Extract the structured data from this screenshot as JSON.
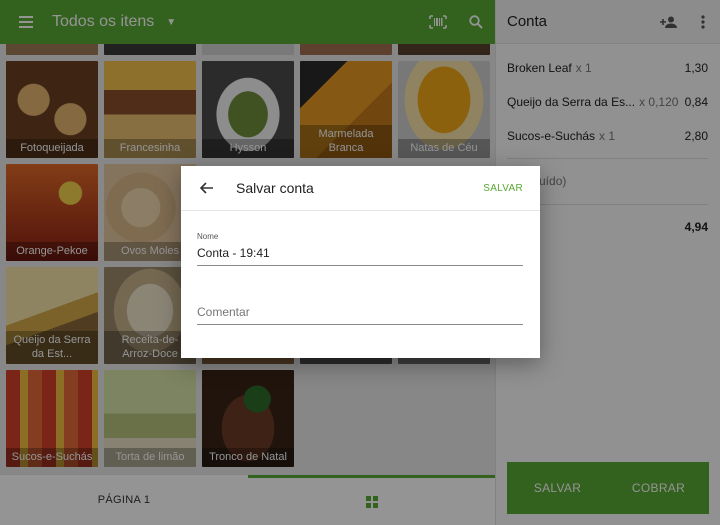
{
  "topbar": {
    "title": "Todos os itens",
    "menu_icon": "menu-icon",
    "barcode_icon": "barcode-icon",
    "search_icon": "search-icon",
    "color": "#59a834"
  },
  "grid": {
    "tiles": [
      {
        "label": "Fotoqueijada",
        "color": "#8a5a32"
      },
      {
        "label": "Francesinha",
        "color": "#b98a3a"
      },
      {
        "label": "Hysson",
        "color": "#6e8b3f"
      },
      {
        "label": "Marmelada Branca",
        "color": "#c98a2a"
      },
      {
        "label": "Natas de Céu",
        "color": "#e0a020"
      },
      {
        "label": "Orange-Pekoe",
        "color": "#b8451e"
      },
      {
        "label": "Ovos Moles",
        "color": "#d8b98a"
      },
      {
        "label": "Queijo da Serra da Est...",
        "color": "#d6b25c"
      },
      {
        "label": "Receita-de-Arroz-Doce",
        "color": "#c9b48c"
      },
      {
        "label": "Sucos-e-Suchás",
        "color": "#b84a2a"
      },
      {
        "label": "Torta de limão",
        "color": "#b7c27c"
      },
      {
        "label": "Tronco de Natal",
        "color": "#5a3322"
      }
    ]
  },
  "bottombar": {
    "page_label": "PÁGINA 1",
    "grid_icon": "grid-icon"
  },
  "panel": {
    "title": "Conta",
    "add_person_icon": "add-person-icon",
    "more_icon": "more-vert-icon",
    "lines": [
      {
        "name": "Broken Leaf",
        "qty": "x 1",
        "price": "1,30"
      },
      {
        "name": "Queijo da Serra da Es...",
        "qty": "x 0,120",
        "price": "0,84"
      },
      {
        "name": "Sucos-e-Suchás",
        "qty": "x 1",
        "price": "2,80"
      }
    ],
    "tax": "o (incluído)",
    "total": "4,94",
    "save_button": "SALVAR",
    "charge_button": "COBRAR"
  },
  "dialog": {
    "title": "Salvar conta",
    "back_icon": "arrow-back-icon",
    "save": "SALVAR",
    "name_label": "Nome",
    "name_value": "Conta - 19:41",
    "comment_placeholder": "Comentar"
  }
}
